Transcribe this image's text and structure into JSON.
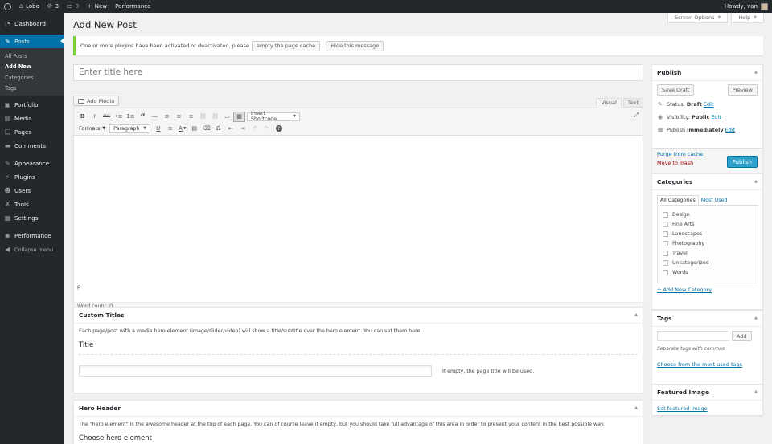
{
  "adminbar": {
    "site_name": "Lobo",
    "updates_count": "3",
    "comments_count": "0",
    "new_label": "New",
    "performance_label": "Performance",
    "howdy": "Howdy, van"
  },
  "sidebar": {
    "dashboard": "Dashboard",
    "posts": "Posts",
    "posts_sub": [
      "All Posts",
      "Add New",
      "Categories",
      "Tags"
    ],
    "portfolio": "Portfolio",
    "media": "Media",
    "pages": "Pages",
    "comments": "Comments",
    "appearance": "Appearance",
    "plugins": "Plugins",
    "users": "Users",
    "tools": "Tools",
    "settings": "Settings",
    "performance": "Performance",
    "collapse": "Collapse menu"
  },
  "screen_meta": {
    "screen_options": "Screen Options",
    "help": "Help"
  },
  "page": {
    "title": "Add New Post"
  },
  "notice": {
    "text": "One or more plugins have been activated or deactivated, please",
    "empty_cache": "empty the page cache",
    "separator": ".",
    "hide": "Hide this message"
  },
  "editor": {
    "title_placeholder": "Enter title here",
    "add_media": "Add Media",
    "tab_visual": "Visual",
    "tab_text": "Text",
    "insert_shortcode": "Insert Shortcode",
    "formats": "Formats",
    "paragraph": "Paragraph",
    "path": "p",
    "word_count": "Word count: 0",
    "toolbar_row1": [
      "B",
      "I",
      "ABC",
      "•≡",
      "1≡",
      "“",
      "—",
      "≡",
      "≡",
      "≡",
      "⛓",
      "⛓",
      "▭",
      "▦"
    ],
    "toolbar_row2": [
      "U",
      "≡",
      "A",
      "▤",
      "⌫",
      "Ω",
      "⇤",
      "⇥",
      "↶",
      "↷",
      "?"
    ]
  },
  "custom_titles": {
    "heading": "Custom Titles",
    "description": "Each page/post with a media hero element (image/slider/video) will show a title/subtitle over the hero element. You can set them here.",
    "field_title": "Title",
    "hint": "If empty, the page title will be used."
  },
  "hero_header": {
    "heading": "Hero Header",
    "description": "The \"hero element\" is the awesome header at the top of each page. You can of course leave it empty, but you should take full advantage of this area in order to present your content in the best possible way.",
    "choose": "Choose hero element"
  },
  "publish": {
    "heading": "Publish",
    "save_draft": "Save Draft",
    "preview": "Preview",
    "status_label": "Status:",
    "status_value": "Draft",
    "visibility_label": "Visibility:",
    "visibility_value": "Public",
    "publish_label": "Publish",
    "publish_value": "immediately",
    "edit": "Edit",
    "purge": "Purge from cache",
    "trash": "Move to Trash",
    "publish_btn": "Publish"
  },
  "categories": {
    "heading": "Categories",
    "tab_all": "All Categories",
    "tab_most": "Most Used",
    "items": [
      "Design",
      "Fine Arts",
      "Landscapes",
      "Photography",
      "Travel",
      "Uncategorized",
      "Words"
    ],
    "add_new": "+ Add New Category"
  },
  "tags": {
    "heading": "Tags",
    "add": "Add",
    "note": "Separate tags with commas",
    "choose": "Choose from the most used tags"
  },
  "featured_image": {
    "heading": "Featured Image",
    "set": "Set featured image"
  },
  "colors": {
    "adminbar_bg": "#23282d",
    "accent": "#0073aa",
    "publish_btn": "#2ea2cc",
    "notice_border": "#7ad03a",
    "trash": "#a00"
  }
}
